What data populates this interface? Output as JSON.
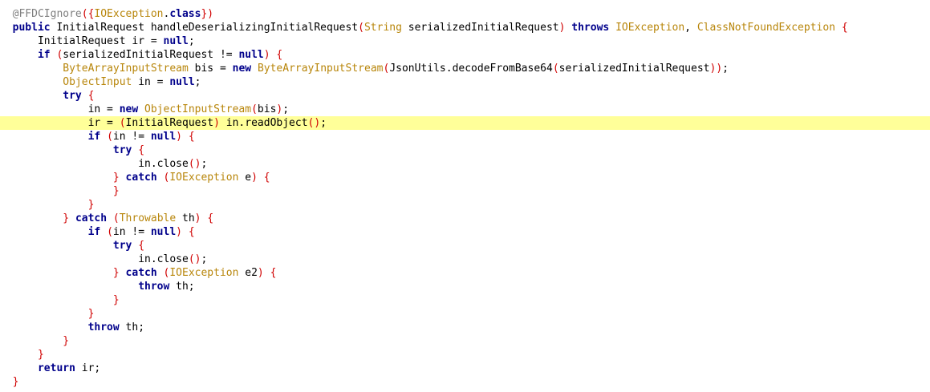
{
  "editor": {
    "language": "Java",
    "highlighted_line": 9,
    "colors": {
      "background": "#ffffff",
      "current_line": "#ffff99",
      "keyword": "#00008b",
      "type": "#b8860b",
      "annotation": "#808080",
      "bracket": "#d00000",
      "text": "#000000"
    },
    "lines": [
      {
        "indent": "  ",
        "tokens": [
          {
            "t": "@FFDCIgnore",
            "c": "ann"
          },
          {
            "t": "(",
            "c": "pn"
          },
          {
            "t": "{",
            "c": "pn"
          },
          {
            "t": "IOException",
            "c": "ty"
          },
          {
            "t": ".",
            "c": "id"
          },
          {
            "t": "class",
            "c": "kw"
          },
          {
            "t": "}",
            "c": "pn"
          },
          {
            "t": ")",
            "c": "pn"
          }
        ]
      },
      {
        "indent": "  ",
        "tokens": [
          {
            "t": "public",
            "c": "kw"
          },
          {
            "t": " InitialRequest handleDeserializingInitialRequest",
            "c": "id"
          },
          {
            "t": "(",
            "c": "pn"
          },
          {
            "t": "String",
            "c": "ty"
          },
          {
            "t": " serializedInitialRequest",
            "c": "id"
          },
          {
            "t": ")",
            "c": "pn"
          },
          {
            "t": " ",
            "c": "id"
          },
          {
            "t": "throws",
            "c": "kw"
          },
          {
            "t": " ",
            "c": "id"
          },
          {
            "t": "IOException",
            "c": "ty"
          },
          {
            "t": ", ",
            "c": "id"
          },
          {
            "t": "ClassNotFoundException",
            "c": "ty"
          },
          {
            "t": " ",
            "c": "id"
          },
          {
            "t": "{",
            "c": "pn"
          }
        ]
      },
      {
        "indent": "      ",
        "tokens": [
          {
            "t": "InitialRequest ir = ",
            "c": "id"
          },
          {
            "t": "null",
            "c": "kw"
          },
          {
            "t": ";",
            "c": "id"
          }
        ]
      },
      {
        "indent": "      ",
        "tokens": [
          {
            "t": "if",
            "c": "kw"
          },
          {
            "t": " ",
            "c": "id"
          },
          {
            "t": "(",
            "c": "pn"
          },
          {
            "t": "serializedInitialRequest != ",
            "c": "id"
          },
          {
            "t": "null",
            "c": "kw"
          },
          {
            "t": ")",
            "c": "pn"
          },
          {
            "t": " ",
            "c": "id"
          },
          {
            "t": "{",
            "c": "pn"
          }
        ]
      },
      {
        "indent": "          ",
        "tokens": [
          {
            "t": "ByteArrayInputStream",
            "c": "ty"
          },
          {
            "t": " bis = ",
            "c": "id"
          },
          {
            "t": "new",
            "c": "kw"
          },
          {
            "t": " ",
            "c": "id"
          },
          {
            "t": "ByteArrayInputStream",
            "c": "ty"
          },
          {
            "t": "(",
            "c": "pn"
          },
          {
            "t": "JsonUtils.decodeFromBase64",
            "c": "id"
          },
          {
            "t": "(",
            "c": "pn"
          },
          {
            "t": "serializedInitialRequest",
            "c": "id"
          },
          {
            "t": ")",
            "c": "pn"
          },
          {
            "t": ")",
            "c": "pn"
          },
          {
            "t": ";",
            "c": "id"
          }
        ]
      },
      {
        "indent": "          ",
        "tokens": [
          {
            "t": "ObjectInput",
            "c": "ty"
          },
          {
            "t": " in = ",
            "c": "id"
          },
          {
            "t": "null",
            "c": "kw"
          },
          {
            "t": ";",
            "c": "id"
          }
        ]
      },
      {
        "indent": "          ",
        "tokens": [
          {
            "t": "try",
            "c": "kw"
          },
          {
            "t": " ",
            "c": "id"
          },
          {
            "t": "{",
            "c": "pn"
          }
        ]
      },
      {
        "indent": "              ",
        "tokens": [
          {
            "t": "in = ",
            "c": "id"
          },
          {
            "t": "new",
            "c": "kw"
          },
          {
            "t": " ",
            "c": "id"
          },
          {
            "t": "ObjectInputStream",
            "c": "ty"
          },
          {
            "t": "(",
            "c": "pn"
          },
          {
            "t": "bis",
            "c": "id"
          },
          {
            "t": ")",
            "c": "pn"
          },
          {
            "t": ";",
            "c": "id"
          }
        ]
      },
      {
        "indent": "              ",
        "tokens": [
          {
            "t": "ir = ",
            "c": "id"
          },
          {
            "t": "(",
            "c": "pn"
          },
          {
            "t": "InitialRequest",
            "c": "id"
          },
          {
            "t": ")",
            "c": "pn"
          },
          {
            "t": " in.readObject",
            "c": "id"
          },
          {
            "t": "(",
            "c": "pn"
          },
          {
            "t": ")",
            "c": "pn"
          },
          {
            "t": ";",
            "c": "id"
          }
        ]
      },
      {
        "indent": "              ",
        "tokens": [
          {
            "t": "if",
            "c": "kw"
          },
          {
            "t": " ",
            "c": "id"
          },
          {
            "t": "(",
            "c": "pn"
          },
          {
            "t": "in != ",
            "c": "id"
          },
          {
            "t": "null",
            "c": "kw"
          },
          {
            "t": ")",
            "c": "pn"
          },
          {
            "t": " ",
            "c": "id"
          },
          {
            "t": "{",
            "c": "pn"
          }
        ]
      },
      {
        "indent": "                  ",
        "tokens": [
          {
            "t": "try",
            "c": "kw"
          },
          {
            "t": " ",
            "c": "id"
          },
          {
            "t": "{",
            "c": "pn"
          }
        ]
      },
      {
        "indent": "                      ",
        "tokens": [
          {
            "t": "in.close",
            "c": "id"
          },
          {
            "t": "(",
            "c": "pn"
          },
          {
            "t": ")",
            "c": "pn"
          },
          {
            "t": ";",
            "c": "id"
          }
        ]
      },
      {
        "indent": "                  ",
        "tokens": [
          {
            "t": "}",
            "c": "pn"
          },
          {
            "t": " ",
            "c": "id"
          },
          {
            "t": "catch",
            "c": "kw"
          },
          {
            "t": " ",
            "c": "id"
          },
          {
            "t": "(",
            "c": "pn"
          },
          {
            "t": "IOException",
            "c": "ty"
          },
          {
            "t": " e",
            "c": "id"
          },
          {
            "t": ")",
            "c": "pn"
          },
          {
            "t": " ",
            "c": "id"
          },
          {
            "t": "{",
            "c": "pn"
          }
        ]
      },
      {
        "indent": "                  ",
        "tokens": [
          {
            "t": "}",
            "c": "pn"
          }
        ]
      },
      {
        "indent": "              ",
        "tokens": [
          {
            "t": "}",
            "c": "pn"
          }
        ]
      },
      {
        "indent": "          ",
        "tokens": [
          {
            "t": "}",
            "c": "pn"
          },
          {
            "t": " ",
            "c": "id"
          },
          {
            "t": "catch",
            "c": "kw"
          },
          {
            "t": " ",
            "c": "id"
          },
          {
            "t": "(",
            "c": "pn"
          },
          {
            "t": "Throwable",
            "c": "ty"
          },
          {
            "t": " th",
            "c": "id"
          },
          {
            "t": ")",
            "c": "pn"
          },
          {
            "t": " ",
            "c": "id"
          },
          {
            "t": "{",
            "c": "pn"
          }
        ]
      },
      {
        "indent": "              ",
        "tokens": [
          {
            "t": "if",
            "c": "kw"
          },
          {
            "t": " ",
            "c": "id"
          },
          {
            "t": "(",
            "c": "pn"
          },
          {
            "t": "in != ",
            "c": "id"
          },
          {
            "t": "null",
            "c": "kw"
          },
          {
            "t": ")",
            "c": "pn"
          },
          {
            "t": " ",
            "c": "id"
          },
          {
            "t": "{",
            "c": "pn"
          }
        ]
      },
      {
        "indent": "                  ",
        "tokens": [
          {
            "t": "try",
            "c": "kw"
          },
          {
            "t": " ",
            "c": "id"
          },
          {
            "t": "{",
            "c": "pn"
          }
        ]
      },
      {
        "indent": "                      ",
        "tokens": [
          {
            "t": "in.close",
            "c": "id"
          },
          {
            "t": "(",
            "c": "pn"
          },
          {
            "t": ")",
            "c": "pn"
          },
          {
            "t": ";",
            "c": "id"
          }
        ]
      },
      {
        "indent": "                  ",
        "tokens": [
          {
            "t": "}",
            "c": "pn"
          },
          {
            "t": " ",
            "c": "id"
          },
          {
            "t": "catch",
            "c": "kw"
          },
          {
            "t": " ",
            "c": "id"
          },
          {
            "t": "(",
            "c": "pn"
          },
          {
            "t": "IOException",
            "c": "ty"
          },
          {
            "t": " e2",
            "c": "id"
          },
          {
            "t": ")",
            "c": "pn"
          },
          {
            "t": " ",
            "c": "id"
          },
          {
            "t": "{",
            "c": "pn"
          }
        ]
      },
      {
        "indent": "                      ",
        "tokens": [
          {
            "t": "throw",
            "c": "kw"
          },
          {
            "t": " th;",
            "c": "id"
          }
        ]
      },
      {
        "indent": "                  ",
        "tokens": [
          {
            "t": "}",
            "c": "pn"
          }
        ]
      },
      {
        "indent": "              ",
        "tokens": [
          {
            "t": "}",
            "c": "pn"
          }
        ]
      },
      {
        "indent": "              ",
        "tokens": [
          {
            "t": "throw",
            "c": "kw"
          },
          {
            "t": " th;",
            "c": "id"
          }
        ]
      },
      {
        "indent": "          ",
        "tokens": [
          {
            "t": "}",
            "c": "pn"
          }
        ]
      },
      {
        "indent": "      ",
        "tokens": [
          {
            "t": "}",
            "c": "pn"
          }
        ]
      },
      {
        "indent": "      ",
        "tokens": [
          {
            "t": "return",
            "c": "kw"
          },
          {
            "t": " ir;",
            "c": "id"
          }
        ]
      },
      {
        "indent": "  ",
        "tokens": [
          {
            "t": "}",
            "c": "pn"
          }
        ]
      }
    ]
  }
}
